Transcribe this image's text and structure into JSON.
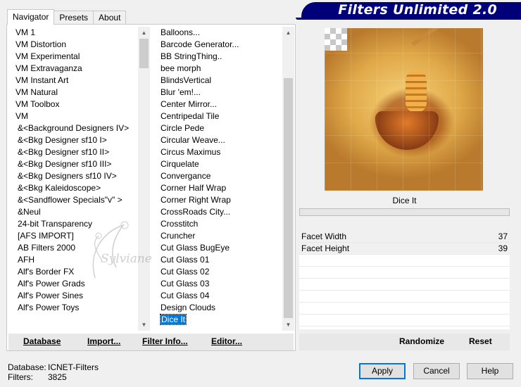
{
  "tabs": [
    "Navigator",
    "Presets",
    "About"
  ],
  "title": "Filters Unlimited 2.0",
  "categories": [
    "VM 1",
    "VM Distortion",
    "VM Experimental",
    "VM Extravaganza",
    "VM Instant Art",
    "VM Natural",
    "VM Toolbox",
    "VM",
    "&<Background Designers IV>",
    "&<Bkg Designer sf10 I>",
    "&<Bkg Designer sf10 II>",
    "&<Bkg Designer sf10 III>",
    "&<Bkg Designers sf10 IV>",
    "&<Bkg Kaleidoscope>",
    "&<Sandflower Specials\"v\" >",
    "&Neul",
    "24-bit Transparency",
    "[AFS IMPORT]",
    "AB Filters 2000",
    "AFH",
    "Alf's Border FX",
    "Alf's Power Grads",
    "Alf's Power Sines",
    "Alf's Power Toys"
  ],
  "filters": [
    "Balloons...",
    "Barcode Generator...",
    "BB StringThing..",
    "bee morph",
    "BlindsVertical",
    "Blur 'em!...",
    "Center Mirror...",
    "Centripedal Tile",
    "Circle Pede",
    "Circular Weave...",
    "Circus Maximus",
    "Cirquelate",
    "Convergance",
    "Corner Half Wrap",
    "Corner Right Wrap",
    "CrossRoads City...",
    "Crosstitch",
    "Cruncher",
    "Cut Glass  BugEye",
    "Cut Glass 01",
    "Cut Glass 02",
    "Cut Glass 03",
    "Cut Glass 04",
    "Design Clouds",
    "Dice It"
  ],
  "selected_filter_index": 24,
  "left_links": {
    "database": "Database",
    "import": "Import...",
    "filter_info": "Filter Info...",
    "editor": "Editor..."
  },
  "filter_name": "Dice It",
  "params": [
    {
      "name": "Facet Width",
      "value": "37"
    },
    {
      "name": "Facet Height",
      "value": "39"
    }
  ],
  "right_links": {
    "randomize": "Randomize",
    "reset": "Reset"
  },
  "status": {
    "database_label": "Database:",
    "database_value": "ICNET-Filters",
    "filters_label": "Filters:",
    "filters_value": "3825"
  },
  "buttons": {
    "apply": "Apply",
    "cancel": "Cancel",
    "help": "Help"
  },
  "watermark": "Sylviane",
  "colors": {
    "banner": "#00007a",
    "selection": "#0078d7"
  }
}
